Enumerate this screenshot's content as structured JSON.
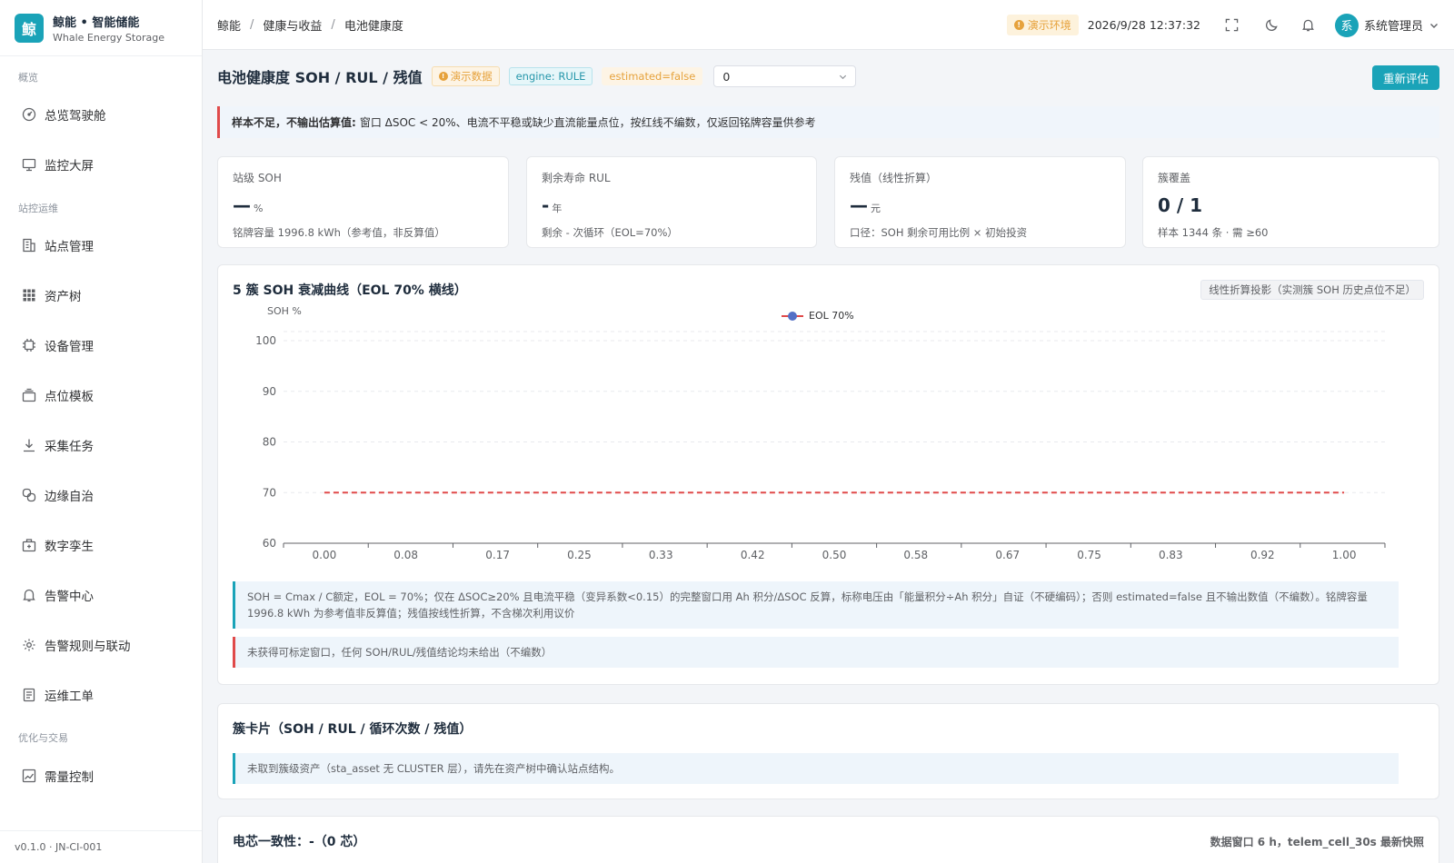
{
  "brand": {
    "logo_char": "鲸",
    "title": "鲸能 • 智能储能",
    "subtitle": "Whale Energy Storage"
  },
  "sidebar": {
    "groups": [
      "概览",
      "站控运维",
      "优化与交易"
    ],
    "items": [
      {
        "label": "总览驾驶舱",
        "icon": "dashboard-icon"
      },
      {
        "label": "监控大屏",
        "icon": "monitor-icon"
      },
      {
        "label": "站点管理",
        "icon": "building-icon"
      },
      {
        "label": "资产树",
        "icon": "grid-icon"
      },
      {
        "label": "设备管理",
        "icon": "chip-icon"
      },
      {
        "label": "点位模板",
        "icon": "template-icon"
      },
      {
        "label": "采集任务",
        "icon": "download-icon"
      },
      {
        "label": "边缘自治",
        "icon": "link-icon"
      },
      {
        "label": "数字孪生",
        "icon": "box-icon"
      },
      {
        "label": "告警中心",
        "icon": "bell-icon"
      },
      {
        "label": "告警规则与联动",
        "icon": "gear-icon"
      },
      {
        "label": "运维工单",
        "icon": "document-icon"
      },
      {
        "label": "需量控制",
        "icon": "chart-icon"
      }
    ],
    "version": "v0.1.0 · JN-CI-001"
  },
  "header": {
    "breadcrumb": [
      "鲸能",
      "健康与收益",
      "电池健康度"
    ],
    "env_tag": "演示环境",
    "datetime": "2026/9/28 12:37:32",
    "avatar_char": "系",
    "user": "系统管理员"
  },
  "page": {
    "title": "电池健康度 SOH / RUL / 残值",
    "tags": {
      "demo": "演示数据",
      "engine": "engine: RULE",
      "estimated": "estimated=false"
    },
    "select_value": "0",
    "reestimate_button": "重新评估",
    "alert_bold": "样本不足，不输出估算值:",
    "alert_text": "窗口 ΔSOC < 20%、电流不平稳或缺少直流能量点位，按红线不编数，仅返回铭牌容量供参考"
  },
  "kpis": [
    {
      "label": "站级 SOH",
      "value": "—",
      "unit": "%",
      "sub": "铭牌容量 1996.8 kWh（参考值，非反算值）"
    },
    {
      "label": "剩余寿命 RUL",
      "value": "-",
      "unit": "年",
      "sub": "剩余 - 次循环（EOL=70%）"
    },
    {
      "label": "残值（线性折算）",
      "value": "—",
      "unit": "元",
      "sub": "口径：SOH 剩余可用比例 × 初始投资"
    },
    {
      "label": "簇覆盖",
      "value": "0 / 1",
      "unit": "",
      "sub": "样本 1344 条 · 需 ≥60"
    }
  ],
  "soh_card": {
    "title": "5 簇 SOH 衰减曲线（EOL 70% 横线）",
    "chip": "线性折算投影（实测簇 SOH 历史点位不足）",
    "note_formula": "SOH = Cmax / C额定，EOL = 70%；仅在 ΔSOC≥20% 且电流平稳（变异系数<0.15）的完整窗口用 Ah 积分/ΔSOC 反算，标称电压由「能量积分÷Ah 积分」自证（不硬编码）；否则 estimated=false 且不输出数值（不编数）。铭牌容量 1996.8 kWh 为参考值非反算值；残值按线性折算，不含梯次利用议价",
    "note_warn": "未获得可标定窗口，任何 SOH/RUL/残值结论均未给出（不编数）"
  },
  "chart_data": {
    "type": "line",
    "ylabel": "SOH %",
    "ylim": [
      60,
      100
    ],
    "y_ticks": [
      100,
      90,
      80,
      70,
      60
    ],
    "x_ticks": [
      "0.00",
      "0.08",
      "0.17",
      "0.25",
      "0.33",
      "0.42",
      "0.50",
      "0.58",
      "0.67",
      "0.75",
      "0.83",
      "0.92",
      "1.00"
    ],
    "xlim": [
      -0.04,
      1.04
    ],
    "grid": true,
    "legend_position": "top-center",
    "series": [
      {
        "name": "EOL 70%",
        "style": "dashed",
        "color": "#e04a4a",
        "x": [
          0,
          1
        ],
        "y": [
          70,
          70
        ]
      }
    ]
  },
  "cluster_card": {
    "title": "簇卡片（SOH / RUL / 循环次数 / 残值）",
    "note": "未取到簇级资产（sta_asset 无 CLUSTER 层），请先在资产树中确认站点结构。"
  },
  "cell_card": {
    "title": "电芯一致性：-（0 芯）",
    "right_note": "数据窗口 6 h，telem_cell_30s 最新快照"
  },
  "colors": {
    "accent": "#1aa3b8",
    "danger": "#e04a4a",
    "warning": "#e6a23c"
  }
}
